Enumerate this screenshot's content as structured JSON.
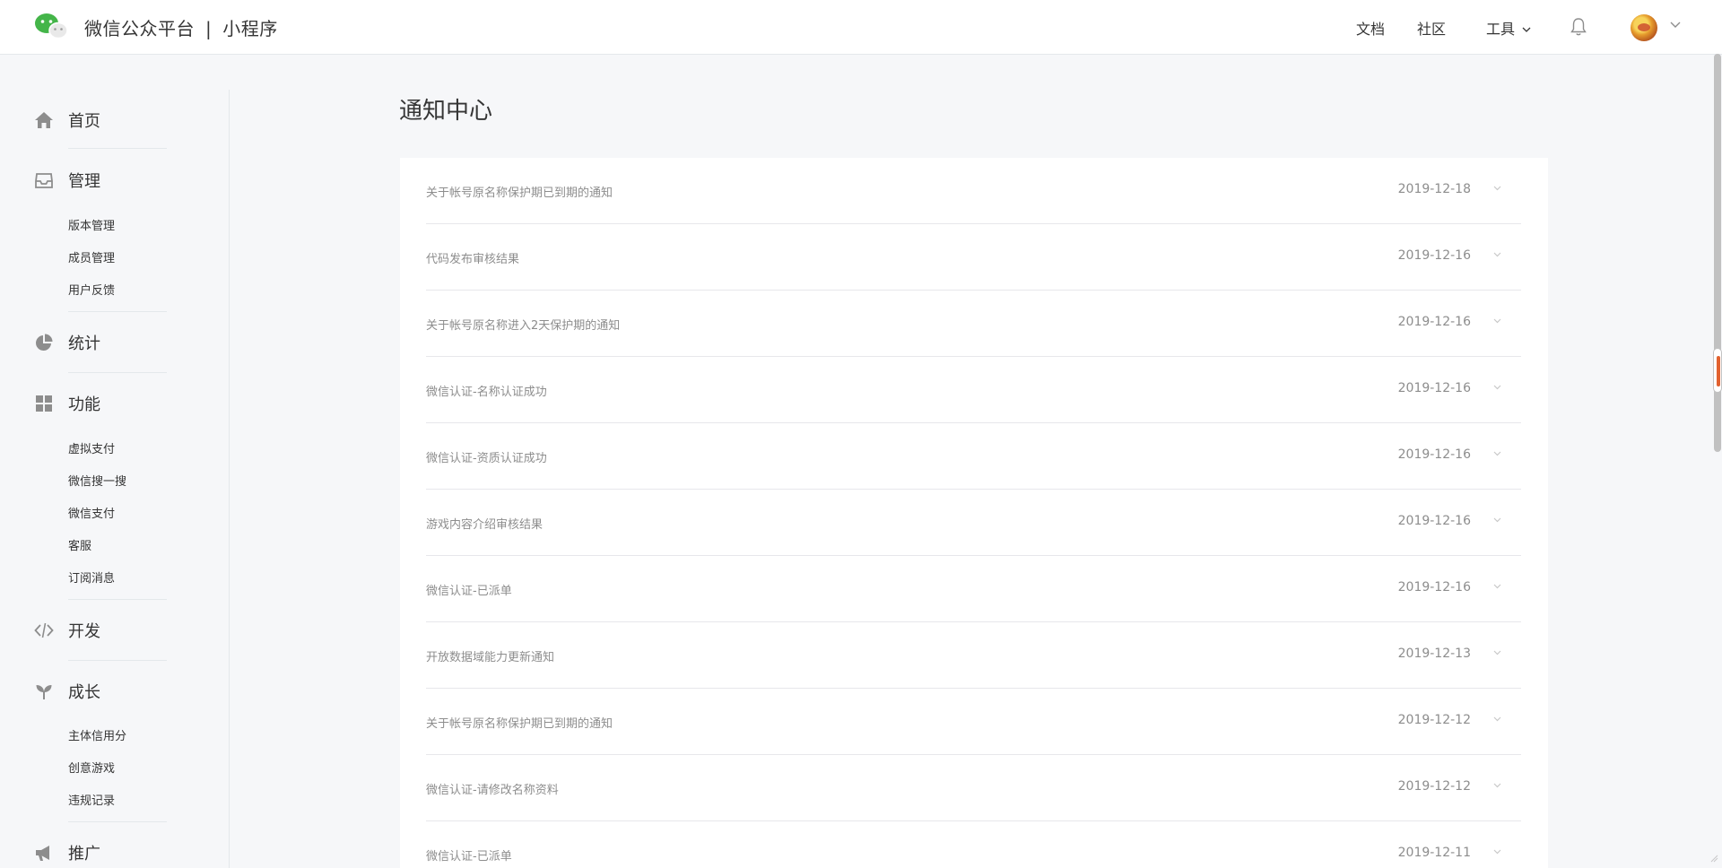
{
  "header": {
    "brand_name": "微信公众平台",
    "brand_separator": "|",
    "product_name": "小程序",
    "nav": {
      "docs": "文档",
      "community": "社区",
      "tools": "工具"
    }
  },
  "sidebar": {
    "home": {
      "label": "首页",
      "icon": "home-icon"
    },
    "manage": {
      "label": "管理",
      "icon": "inbox-icon",
      "items": [
        "版本管理",
        "成员管理",
        "用户反馈"
      ]
    },
    "stats": {
      "label": "统计",
      "icon": "pie-chart-icon"
    },
    "features": {
      "label": "功能",
      "icon": "grid-icon",
      "items": [
        "虚拟支付",
        "微信搜一搜",
        "微信支付",
        "客服",
        "订阅消息"
      ]
    },
    "develop": {
      "label": "开发",
      "icon": "code-icon"
    },
    "growth": {
      "label": "成长",
      "icon": "sprout-icon",
      "items": [
        "主体信用分",
        "创意游戏",
        "违规记录"
      ]
    },
    "promote": {
      "label": "推广",
      "icon": "megaphone-icon"
    }
  },
  "main": {
    "title": "通知中心",
    "notices": [
      {
        "title": "关于帐号原名称保护期已到期的通知",
        "date": "2019-12-18"
      },
      {
        "title": "代码发布审核结果",
        "date": "2019-12-16"
      },
      {
        "title": "关于帐号原名称进入2天保护期的通知",
        "date": "2019-12-16"
      },
      {
        "title": "微信认证-名称认证成功",
        "date": "2019-12-16"
      },
      {
        "title": "微信认证-资质认证成功",
        "date": "2019-12-16"
      },
      {
        "title": "游戏内容介绍审核结果",
        "date": "2019-12-16"
      },
      {
        "title": "微信认证-已派单",
        "date": "2019-12-16"
      },
      {
        "title": "开放数据域能力更新通知",
        "date": "2019-12-13"
      },
      {
        "title": "关于帐号原名称保护期已到期的通知",
        "date": "2019-12-12"
      },
      {
        "title": "微信认证-请修改名称资料",
        "date": "2019-12-12"
      },
      {
        "title": "微信认证-已派单",
        "date": "2019-12-11"
      }
    ]
  },
  "colors": {
    "page_bg": "#f6f7f9",
    "text": "#353535",
    "muted_text": "#8d8d8d",
    "divider": "#e7e7eb",
    "wechat_green": "#44b549",
    "icon_gray": "#8d8d8d"
  }
}
